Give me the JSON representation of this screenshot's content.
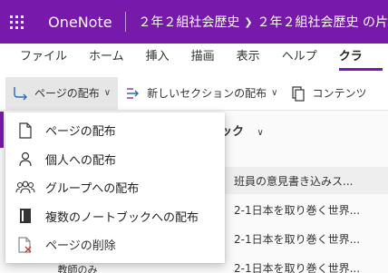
{
  "titlebar": {
    "app_name": "OneNote",
    "breadcrumb_1": "２年２組社会歴史",
    "breadcrumb_2": "２年２組社会歴史 の片",
    "accent": "#7719aa"
  },
  "ribbon_tabs": [
    {
      "label": "ファイル"
    },
    {
      "label": "ホーム"
    },
    {
      "label": "挿入"
    },
    {
      "label": "描画"
    },
    {
      "label": "表示"
    },
    {
      "label": "ヘルプ"
    },
    {
      "label": "クラ"
    }
  ],
  "commands": {
    "distribute_page": "ページの配布",
    "distribute_new_section": "新しいセクションの配布",
    "content": "コンテンツ"
  },
  "menu": {
    "items": [
      {
        "label": "ページの配布",
        "icon": "page-icon"
      },
      {
        "label": "個人への配布",
        "icon": "person-icon"
      },
      {
        "label": "グループへの配布",
        "icon": "group-icon"
      },
      {
        "label": "複数のノートブックへの配布",
        "icon": "notebooks-icon"
      },
      {
        "label": "ページの削除",
        "icon": "delete-page-icon"
      }
    ]
  },
  "background": {
    "notebook_header": "ブック",
    "pages": [
      "班員の意見書き込みス...",
      "2-1日本を取り巻く世界...",
      "2-1日本を取り巻く世界...",
      "2-1日本を取り巻く世界..."
    ],
    "teacher_item": "_教師のみ"
  }
}
